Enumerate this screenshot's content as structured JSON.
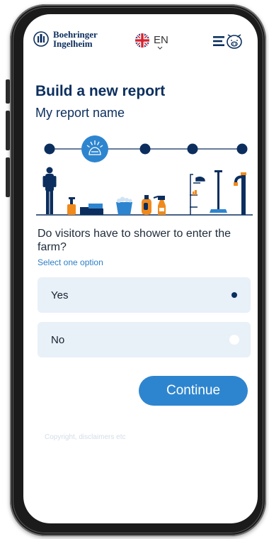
{
  "header": {
    "brand_line1": "Boehringer",
    "brand_line2": "Ingelheim",
    "language": "EN"
  },
  "page": {
    "title": "Build a new report",
    "subtitle": "My report name"
  },
  "stepper": {
    "total_steps": 5,
    "current_step": 2
  },
  "question": {
    "text": "Do visitors have to shower to enter the farm?",
    "hint": "Select one option"
  },
  "options": [
    {
      "label": "Yes",
      "selected": true
    },
    {
      "label": "No",
      "selected": false
    }
  ],
  "continue_label": "Continue",
  "footer_text": "Copyright, disclaimers etc",
  "colors": {
    "navy": "#0b2e5e",
    "accent": "#2e85cf",
    "option_bg": "#e8f0f8",
    "orange": "#f08a1c"
  }
}
